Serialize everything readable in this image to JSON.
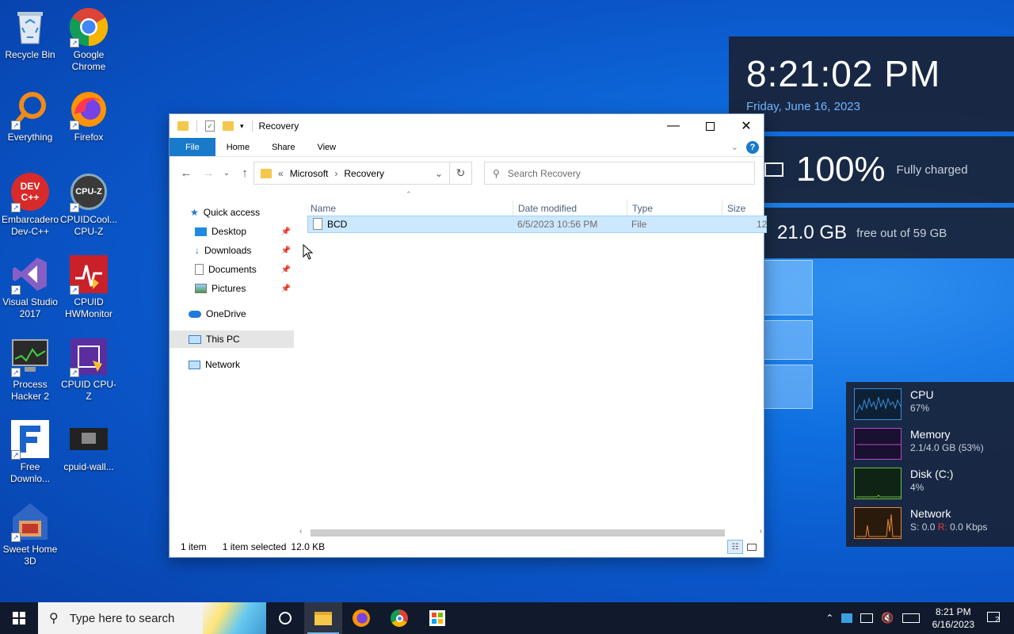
{
  "desktop": {
    "icons": [
      {
        "label": "Recycle Bin"
      },
      {
        "label": "Google Chrome"
      },
      {
        "label": "Everything"
      },
      {
        "label": "Firefox"
      },
      {
        "label": "Embarcadero Dev-C++"
      },
      {
        "label": "CPUIDCool... CPU-Z"
      },
      {
        "label": "Visual Studio 2017"
      },
      {
        "label": "CPUID HWMonitor"
      },
      {
        "label": "Process Hacker 2"
      },
      {
        "label": "CPUID CPU-Z"
      },
      {
        "label": "Free Downlo..."
      },
      {
        "label": "cpuid-wall..."
      },
      {
        "label": "Sweet Home 3D"
      }
    ],
    "icon_badges": {
      "devc": "DEV C++",
      "cpuz": "CPU-Z"
    }
  },
  "widgets": {
    "clock": {
      "time": "8:21:02 PM",
      "date": "Friday, June 16, 2023"
    },
    "battery": {
      "percent": "100%",
      "status": "Fully charged"
    },
    "disk": {
      "free": "21.0 GB",
      "detail": "free out of 59 GB"
    },
    "monitor": [
      {
        "name": "CPU",
        "value": "67%",
        "color": "#3a8fd6"
      },
      {
        "name": "Memory",
        "value": "2.1/4.0 GB (53%)",
        "color": "#b04bc8"
      },
      {
        "name": "Disk (C:)",
        "value": "4%",
        "color": "#6fbf4a"
      },
      {
        "name": "Network",
        "value_s_label": "S:",
        "value_s": "0.0",
        "value_r_label": "R:",
        "value_r": "0.0 Kbps",
        "color": "#e08a3a"
      }
    ]
  },
  "explorer": {
    "title": "Recovery",
    "ribbon_tabs": [
      "File",
      "Home",
      "Share",
      "View"
    ],
    "address": {
      "overflow": "«",
      "segments": [
        "Microsoft",
        "Recovery"
      ]
    },
    "search_placeholder": "Search Recovery",
    "nav": {
      "quick_access": "Quick access",
      "items": [
        {
          "label": "Desktop",
          "pinned": true
        },
        {
          "label": "Downloads",
          "pinned": true
        },
        {
          "label": "Documents",
          "pinned": true
        },
        {
          "label": "Pictures",
          "pinned": true
        }
      ],
      "onedrive": "OneDrive",
      "thispc": "This PC",
      "network": "Network"
    },
    "columns": [
      "Name",
      "Date modified",
      "Type",
      "Size"
    ],
    "files": [
      {
        "name": "BCD",
        "date": "6/5/2023 10:56 PM",
        "type": "File",
        "size": "12"
      }
    ],
    "status": {
      "count": "1 item",
      "selected": "1 item selected",
      "size": "12.0 KB"
    }
  },
  "taskbar": {
    "search_placeholder": "Type here to search",
    "clock_time": "8:21 PM",
    "clock_date": "6/16/2023",
    "notification_count": "2"
  },
  "colors": {
    "accent": "#1979ca",
    "selection": "#cce8ff",
    "taskbar": "#101a2c"
  }
}
